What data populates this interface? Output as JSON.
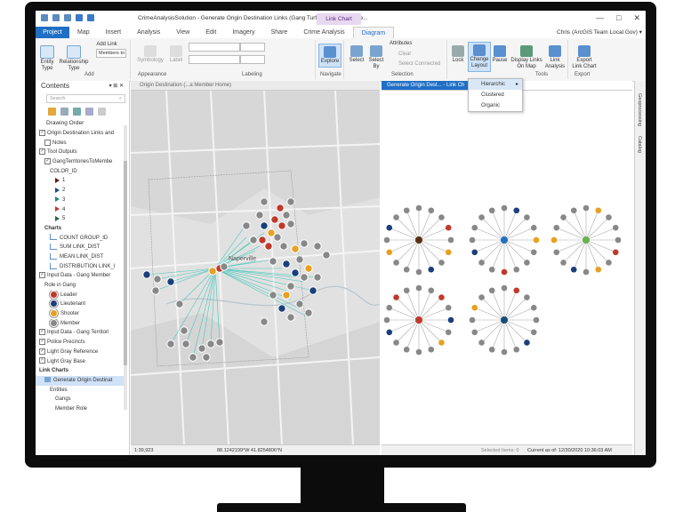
{
  "window": {
    "title": "CrimeAnalysisSolution - Generate Origin Destination Links (Gang Turf to Member Home...",
    "context_tab": "Link Chart",
    "controls": [
      "—",
      "□",
      "✕"
    ]
  },
  "tabs": [
    "Project",
    "Map",
    "Insert",
    "Analysis",
    "View",
    "Edit",
    "Imagery",
    "Share",
    "Crime Analysis",
    "Diagram"
  ],
  "active_tab": "Diagram",
  "user": "Chris (ArcGIS Team Local Gov) ▾",
  "ribbon": {
    "add_link": "Add Link",
    "members_select": "Members to",
    "entity_type": "Entity\nType",
    "relationship_type": "Relationship\nType",
    "symbology": "Symbology",
    "label": "Label",
    "explore": "Explore",
    "select": "Select",
    "select_by": "Select\nBy",
    "attributes": "Attributes",
    "clear": "Clear",
    "select_connected": "Select Connected",
    "lock": "Lock",
    "change_layout": "Change\nLayout",
    "pause": "Pause",
    "display_links": "Display Links\nOn Map",
    "link_analysis": "Link\nAnalysis",
    "export_chart": "Export\nLink Chart",
    "groups": [
      "Add",
      "Appearance",
      "Labeling",
      "Navigate",
      "Selection",
      "Tools",
      "Export"
    ]
  },
  "layout_menu": {
    "items": [
      "Hierarchic",
      "Clustered",
      "Organic"
    ],
    "selected": "Hierarchic"
  },
  "contents": {
    "title": "Contents",
    "search_placeholder": "Search",
    "drawing_order": "Drawing Order",
    "rows": [
      {
        "t": "Origin Destination Links and",
        "d": 0,
        "chk": true
      },
      {
        "t": "Notes",
        "d": 1,
        "chk": false
      },
      {
        "t": "Tool Outputs",
        "d": 0,
        "chk": true
      },
      {
        "t": "GangTerritoriesToMembe",
        "d": 1,
        "chk": true
      },
      {
        "t": "COLOR_ID",
        "d": 2,
        "chk": null
      },
      {
        "t": "1",
        "d": 3,
        "sym": "#5a1e12"
      },
      {
        "t": "2",
        "d": 3,
        "sym": "#1a4a7a"
      },
      {
        "t": "3",
        "d": 3,
        "sym": "#1e8a7a"
      },
      {
        "t": "4",
        "d": 3,
        "sym": "#c0392b"
      },
      {
        "t": "5",
        "d": 3,
        "sym": "#1e6a3a"
      },
      {
        "t": "Charts",
        "d": 1,
        "hdr": true
      },
      {
        "t": "COUNT GROUP_ID",
        "d": 2,
        "chart": true
      },
      {
        "t": "SUM LINK_DIST",
        "d": 2,
        "chart": true
      },
      {
        "t": "MEAN LINK_DIST",
        "d": 2,
        "chart": true
      },
      {
        "t": "DISTRIBUTION LINK_I",
        "d": 2,
        "chart": true
      },
      {
        "t": "Input Data - Gang Member",
        "d": 0,
        "chk": true
      },
      {
        "t": "Role in Gang",
        "d": 1,
        "chk": null
      },
      {
        "t": "Leader",
        "d": 2,
        "role": "#c0392b"
      },
      {
        "t": "Lieutenant",
        "d": 2,
        "role": "#1a3f7a"
      },
      {
        "t": "Shooter",
        "d": 2,
        "role": "#e8a020"
      },
      {
        "t": "Member",
        "d": 2,
        "role": "#888888"
      },
      {
        "t": "Input Data - Gang Territori",
        "d": 0,
        "chk": true
      },
      {
        "t": "Police Precincts",
        "d": 0,
        "chk": true
      },
      {
        "t": "Light Gray Reference",
        "d": 0,
        "chk": true
      },
      {
        "t": "Light Gray Base",
        "d": 0,
        "chk": true
      },
      {
        "t": "Link Charts",
        "d": 0,
        "hdr": true
      },
      {
        "t": "Generate Origin Destinat",
        "d": 1,
        "sel": true
      },
      {
        "t": "Entities",
        "d": 2,
        "chk": null
      },
      {
        "t": "Gangs",
        "d": 3,
        "chk": null
      },
      {
        "t": "Member Role",
        "d": 3,
        "chk": null
      }
    ]
  },
  "views": {
    "map_tab": "Origin Destination (...a Member Home)",
    "link_tab": "Generate Origin Dest... - Link Ch"
  },
  "map": {
    "city_label": "Naperville",
    "scale": "1:39,923",
    "coords": "88.1242199°W 41.8254806°N"
  },
  "link_status": {
    "selected": "Selected Items: 0",
    "current_as_of": "Current as of:  12/30/2020 10:36:03 AM"
  },
  "side_panels": [
    "Geoprocessing",
    "Catalog"
  ],
  "colors": {
    "accent": "#1f6fc5",
    "leader": "#c0392b",
    "lieutenant": "#1a3f7a",
    "shooter": "#e8a020",
    "member": "#888888",
    "territory": "#2ec4b6"
  }
}
